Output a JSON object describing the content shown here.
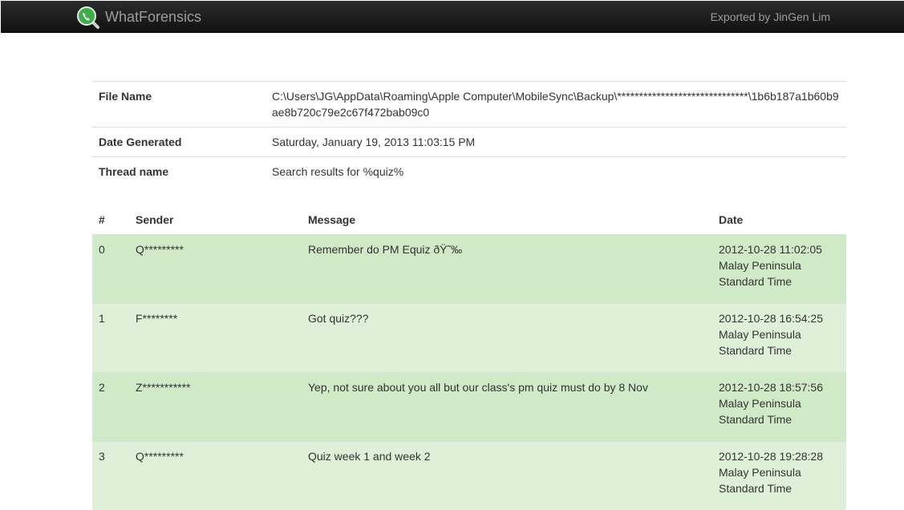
{
  "header": {
    "brand": "WhatForensics",
    "exported_by": "Exported by JinGen Lim",
    "icon": "magnifier-phone-icon"
  },
  "info": [
    {
      "key": "File Name",
      "value": "C:\\Users\\JG\\AppData\\Roaming\\Apple Computer\\MobileSync\\Backup\\******************************\\1b6b187a1b60b9ae8b720c79e2c67f472bab09c0"
    },
    {
      "key": "Date Generated",
      "value": "Saturday, January 19, 2013 11:03:15 PM"
    },
    {
      "key": "Thread name",
      "value": "Search results for %quiz%"
    }
  ],
  "messages_table": {
    "columns": [
      "#",
      "Sender",
      "Message",
      "Date"
    ],
    "rows": [
      {
        "num": "0",
        "sender": "Q*********",
        "message": "Remember do PM Equiz ðŸ˜‰",
        "date_line1": "2012-10-28 11:02:05",
        "date_line2": "Malay Peninsula",
        "date_line3": "Standard Time"
      },
      {
        "num": "1",
        "sender": "F********",
        "message": "Got quiz???",
        "date_line1": "2012-10-28 16:54:25",
        "date_line2": "Malay Peninsula",
        "date_line3": "Standard Time"
      },
      {
        "num": "2",
        "sender": "Z***********",
        "message": "Yep, not sure about you all but our class's pm quiz must do by 8 Nov",
        "date_line1": "2012-10-28 18:57:56",
        "date_line2": "Malay Peninsula",
        "date_line3": "Standard Time"
      },
      {
        "num": "3",
        "sender": "Q*********",
        "message": "Quiz week 1 and week 2",
        "date_line1": "2012-10-28 19:28:28",
        "date_line2": "Malay Peninsula",
        "date_line3": "Standard Time"
      }
    ]
  },
  "colors": {
    "navbar": "#1b1b1b",
    "row_dark": "#d0e9c6",
    "row_light": "#dff0d8",
    "brand_green": "#3fae49"
  }
}
